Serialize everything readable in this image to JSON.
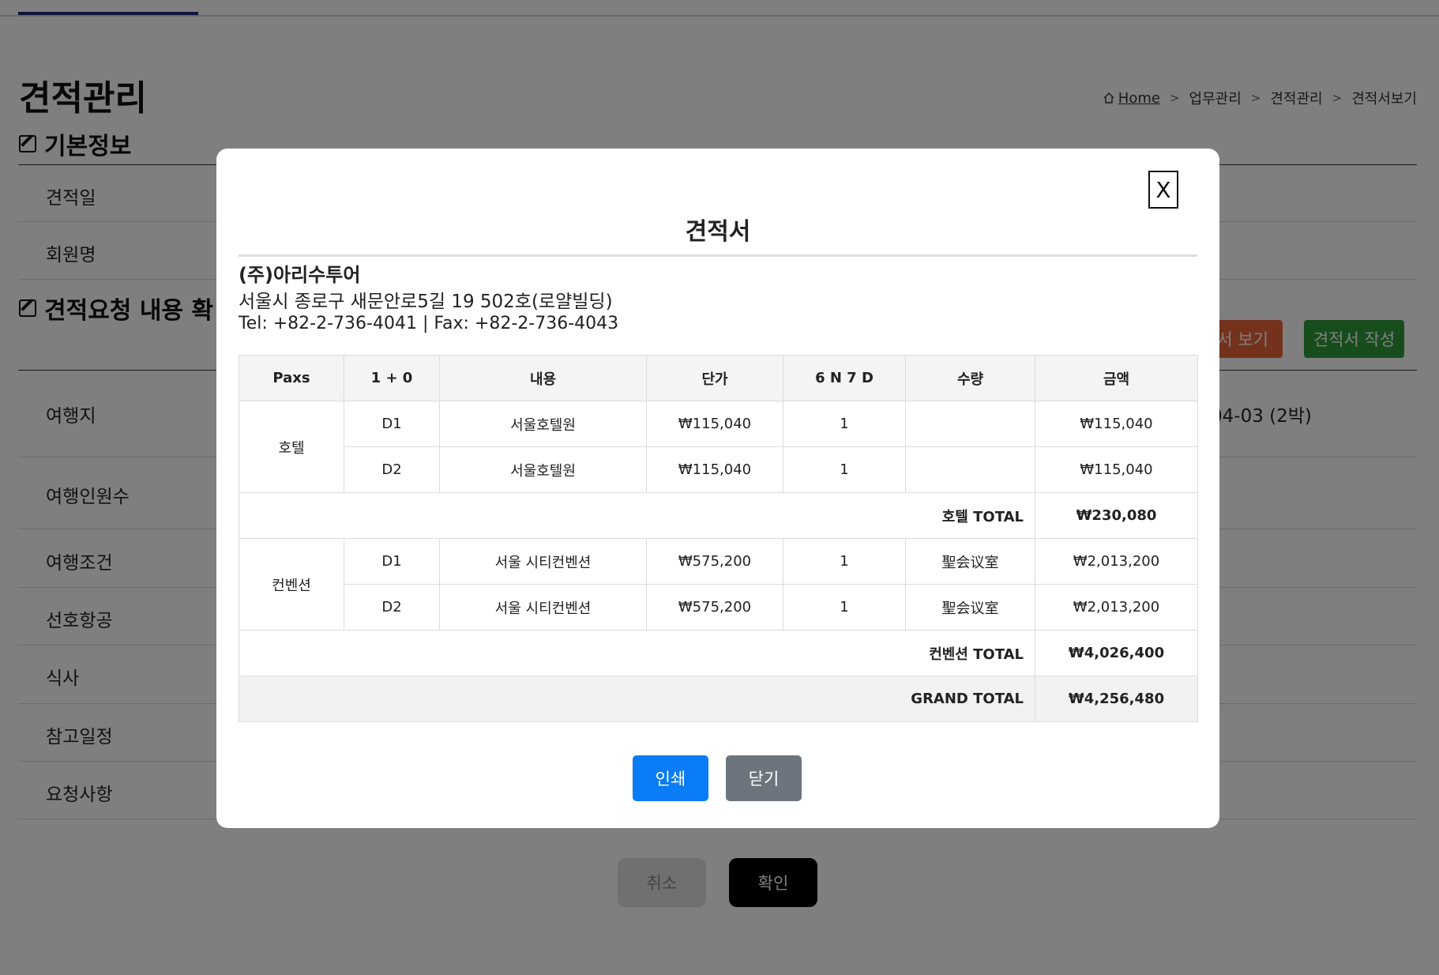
{
  "page": {
    "title": "견적관리",
    "breadcrumb": {
      "home": "Home",
      "separator": ">",
      "items": [
        "업무관리",
        "견적관리",
        "견적서보기"
      ]
    },
    "sections": {
      "basic": "기본정보",
      "request": "견적요청 내용 확"
    },
    "basic_rows": [
      {
        "label": "견적일"
      },
      {
        "label": "회원명"
      }
    ],
    "request_rows": [
      {
        "label": "여행지",
        "value": "04-03 (2박)"
      },
      {
        "label": "여행인원수",
        "value": ""
      },
      {
        "label": "여행조건",
        "value": ")"
      },
      {
        "label": "선호항공",
        "value": ""
      },
      {
        "label": "식사",
        "value": ""
      },
      {
        "label": "참고일정",
        "value": ""
      },
      {
        "label": "요청사항",
        "value": ""
      }
    ],
    "buttons": {
      "preview": "서 보기",
      "write": "견적서 작성",
      "cancel": "취소",
      "confirm": "확인"
    }
  },
  "modal": {
    "close_label": "X",
    "title": "견적서",
    "company": {
      "name": "(주)아리수투어",
      "address": "서울시 종로구 새문안로5길 19 502호(로얄빌딩)",
      "contact": "Tel: +82-2-736-4041 | Fax: +82-2-736-4043"
    },
    "table": {
      "headers": [
        "Paxs",
        "1 + 0",
        "내용",
        "단가",
        "6 N 7 D",
        "수량",
        "금액"
      ],
      "groups": [
        {
          "category": "호텔",
          "rows": [
            {
              "day": "D1",
              "content": "서울호텔원",
              "price": "₩115,040",
              "nights": "1",
              "qty": "",
              "amount": "₩115,040"
            },
            {
              "day": "D2",
              "content": "서울호텔원",
              "price": "₩115,040",
              "nights": "1",
              "qty": "",
              "amount": "₩115,040"
            }
          ],
          "subtotal_label": "호텔 TOTAL",
          "subtotal": "₩230,080"
        },
        {
          "category": "컨벤션",
          "rows": [
            {
              "day": "D1",
              "content": "서울 시티컨벤션",
              "price": "₩575,200",
              "nights": "1",
              "qty": "聖会议室",
              "amount": "₩2,013,200"
            },
            {
              "day": "D2",
              "content": "서울 시티컨벤션",
              "price": "₩575,200",
              "nights": "1",
              "qty": "聖会议室",
              "amount": "₩2,013,200"
            }
          ],
          "subtotal_label": "컨벤션 TOTAL",
          "subtotal": "₩4,026,400"
        }
      ],
      "grand_total_label": "GRAND TOTAL",
      "grand_total": "₩4,256,480"
    },
    "buttons": {
      "print": "인쇄",
      "close": "닫기"
    }
  },
  "colors": {
    "overlay": "rgba(0,0,0,0.5)",
    "print_button": "#0a7cf5",
    "close_button": "#6c757d",
    "preview_button": "#e8643b",
    "write_button": "#2e9b3a",
    "confirm_button": "#000000",
    "nav_active": "#1e2a78"
  }
}
